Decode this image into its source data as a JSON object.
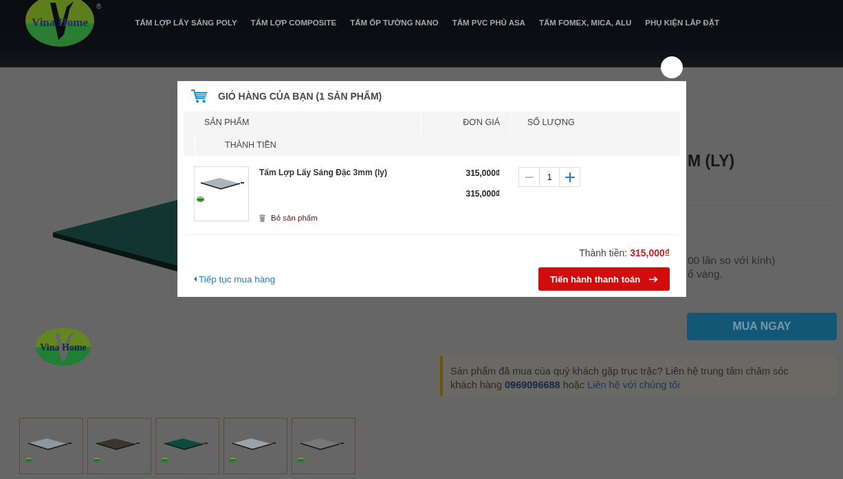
{
  "header": {
    "logo": {
      "text": "Vina Home",
      "mark": "®"
    },
    "nav": [
      {
        "label": "TẤM LỢP LẤY SÁNG POLY"
      },
      {
        "label": "TẤM LỢP COMPOSITE"
      },
      {
        "label": "TẤM ỐP TƯỜNG NANO"
      },
      {
        "label": "TẤM PVC PHỦ ASA"
      },
      {
        "label": "TẤM FOMEX, MICA, ALU"
      },
      {
        "label": "PHỤ KIỆN LẮP ĐẶT"
      }
    ]
  },
  "gallery": {
    "logo_text": "Vina Home",
    "thumbnails": [
      {
        "color": "#8d979c"
      },
      {
        "color": "#3b3431"
      },
      {
        "color": "#0f4a40"
      },
      {
        "color": "#9aa3aa"
      },
      {
        "color": "#777777"
      }
    ]
  },
  "product": {
    "title": "M (LY)",
    "features": [
      "00 lần so với kính)",
      "ố vàng."
    ],
    "buy_button": "MUA NGAY",
    "notice": {
      "text": "Sản phẩm đã mua của quý khách gặp trục trặc? Liên hệ trung tâm chăm sóc khách hàng",
      "phone": "0969096688",
      "middle": "hoặc",
      "link": "Liên hệ với chúng tôi"
    }
  },
  "cart_modal": {
    "title": "GIÓ HÀNG CỦA BẠN (1 SẢN PHẨM)",
    "columns": [
      "SẢN PHẨM",
      "ĐƠN GIÁ",
      "SỐ LƯỢNG",
      "THÀNH TIỀN"
    ],
    "items": [
      {
        "name": "Tấm Lợp Lấy Sáng Đặc 3mm (ly)",
        "remove": "Bỏ sản phẩm",
        "unit_price": "315,000₫",
        "line_total": "315,000₫",
        "quantity": "1"
      }
    ],
    "total_label": "Thành tiền:",
    "total_value": "315,000₫",
    "continue_link": "Tiếp tục mua hàng",
    "checkout_button": "Tiến hành thanh toán"
  }
}
